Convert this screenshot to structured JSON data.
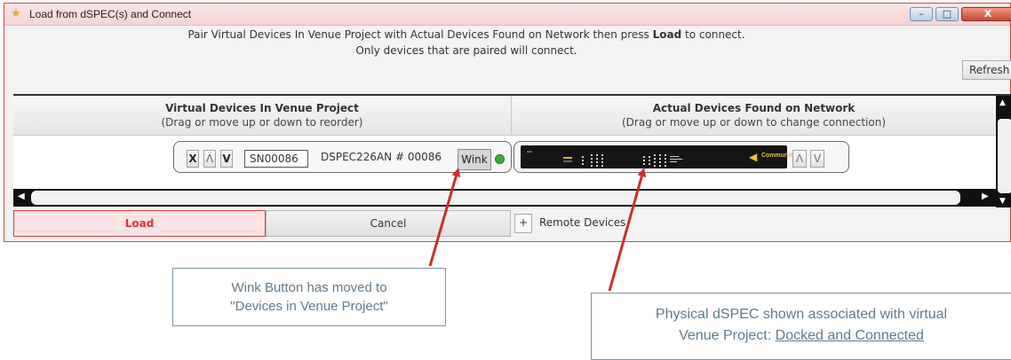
{
  "window": {
    "title": "Load from dSPEC(s) and Connect",
    "buttons": {
      "minimize": "–",
      "maximize": "□",
      "close": "X"
    }
  },
  "instructions": {
    "line1_prefix": "Pair Virtual Devices In Venue Project with Actual Devices Found on Network then press ",
    "line1_bold": "Load",
    "line1_suffix": " to connect.",
    "line2": "Only devices that are paired will connect."
  },
  "refresh_label": "Refresh",
  "columns": {
    "virtual": {
      "title": "Virtual Devices In Venue Project",
      "subtitle": "(Drag or move up or down to reorder)"
    },
    "actual": {
      "title": "Actual Devices Found on Network",
      "subtitle": "(Drag or move up or down to change connection)"
    }
  },
  "row": {
    "remove_label": "X",
    "up_label": "Λ",
    "down_label": "V",
    "serial": "SN00086",
    "device_name": "DSPEC226AN # 00086",
    "wink_label": "Wink",
    "status_color": "#35b035",
    "actual_logo": "Community",
    "actual_up_label": "Λ",
    "actual_down_label": "V"
  },
  "buttons": {
    "load": "Load",
    "cancel": "Cancel",
    "remote_plus": "+",
    "remote_devices": "Remote Devices"
  },
  "annotations": {
    "callout1_line1": "Wink Button has moved to",
    "callout1_line2": "\"Devices in Venue Project\"",
    "callout2_line1": "Physical dSPEC shown associated with virtual",
    "callout2_line2_prefix": "Venue Project: ",
    "callout2_line2_underlined": "Docked and Connected",
    "arrow_color": "#c8302a"
  },
  "colors": {
    "accent_red": "#d94040",
    "window_border": "#c94a4a"
  }
}
